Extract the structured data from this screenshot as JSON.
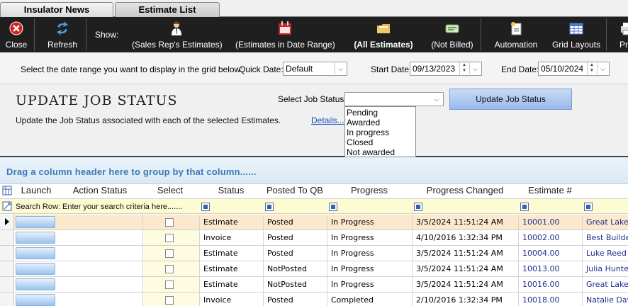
{
  "tabs": [
    {
      "label": "Insulator News"
    },
    {
      "label": "Estimate List"
    }
  ],
  "toolbar": {
    "close": "Close",
    "refresh": "Refresh",
    "show": "Show:",
    "sales_rep": "(Sales Rep's Estimates)",
    "date_range": "(Estimates in Date Range)",
    "all_estimates": "(All Estimates)",
    "not_billed": "(Not Billed)",
    "automation": "Automation",
    "grid_layouts": "Grid Layouts",
    "print_partial": "Pr"
  },
  "date_range": {
    "instruction": "Select the date range you want to display in the grid below:",
    "quick_date_label": "Quick Date:",
    "quick_date_value": "Default",
    "start_label": "Start Date:",
    "start_value": "09/13/2023",
    "end_label": "End Date:",
    "end_value": "05/10/2024"
  },
  "panel": {
    "title": "UPDATE JOB STATUS",
    "description": "Update the Job Status associated with each of the selected Estimates.",
    "details_link": "Details...",
    "select_label": "Select Job Status:",
    "update_button": "Update Job Status",
    "options": [
      "Pending",
      "Awarded",
      "In progress",
      "Closed",
      "Not awarded"
    ]
  },
  "groupby": {
    "text": "Drag a column header here to group by that column......"
  },
  "grid": {
    "headers": [
      "Launch",
      "Action Status",
      "Select",
      "Status",
      "Posted To QB",
      "Progress",
      "Progress Changed",
      "Estimate #"
    ],
    "search_label": "Search Row: Enter your search criteria here.......",
    "rows": [
      {
        "status": "Estimate",
        "posted": "Posted",
        "progress": "In Progress",
        "changed": "3/5/2024 11:51:24 AM",
        "estimate": "10001.00",
        "customer": "Great Lake"
      },
      {
        "status": "Invoice",
        "posted": "Posted",
        "progress": "In Progress",
        "changed": "4/10/2016 1:32:34 PM",
        "estimate": "10002.00",
        "customer": "Best Builde"
      },
      {
        "status": "Estimate",
        "posted": "Posted",
        "progress": "In Progress",
        "changed": "3/5/2024 11:51:24 AM",
        "estimate": "10004.00",
        "customer": "Luke Reed"
      },
      {
        "status": "Estimate",
        "posted": "NotPosted",
        "progress": "In Progress",
        "changed": "3/5/2024 11:51:24 AM",
        "estimate": "10013.00",
        "customer": "Julia Hunte"
      },
      {
        "status": "Estimate",
        "posted": "NotPosted",
        "progress": "In Progress",
        "changed": "3/5/2024 11:51:24 AM",
        "estimate": "10016.00",
        "customer": "Great Lake"
      },
      {
        "status": "Invoice",
        "posted": "Posted",
        "progress": "Completed",
        "changed": "2/10/2016 1:32:34 PM",
        "estimate": "10018.00",
        "customer": "Natalie Dav"
      }
    ]
  },
  "colors": {
    "toolbar_bg": "#1f1f1f",
    "selected_row": "#fce8cc",
    "groupby_text": "#3c7ab8",
    "estimate_number": "#1e2f8c"
  }
}
